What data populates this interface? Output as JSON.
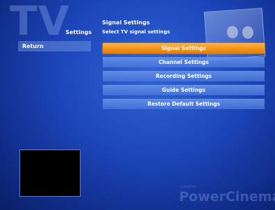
{
  "watermark": {
    "tv": "TV"
  },
  "section": {
    "label": "Settings"
  },
  "header": {
    "title": "Signal Settings",
    "subtitle": "Select TV signal settings"
  },
  "nav": {
    "return_label": "Return"
  },
  "menu": {
    "items": [
      {
        "label": "Signal Settings",
        "active": true
      },
      {
        "label": "Channel Settings",
        "active": false
      },
      {
        "label": "Recording Settings",
        "active": false
      },
      {
        "label": "Guide Settings",
        "active": false
      },
      {
        "label": "Restore Default Settings",
        "active": false
      }
    ]
  },
  "brand": {
    "name": "PowerCinema",
    "small": "CyberLink"
  },
  "colors": {
    "accent": "#f29318",
    "background": "#1c45b8",
    "menu_item": "#5a86dd"
  }
}
